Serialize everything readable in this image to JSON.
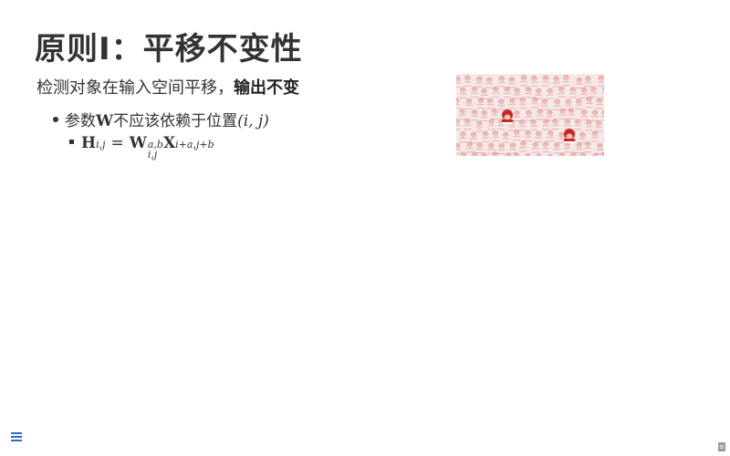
{
  "slide": {
    "title": "原则I：平移不变性",
    "subtitle_plain": "检测对象在输入空间平移，",
    "subtitle_bold": "输出不变",
    "bullet": {
      "text_before": "参数",
      "symbol_W": "W",
      "text_after": "不应该依赖于位置",
      "position": "(i, j)"
    },
    "formula": {
      "H": "H",
      "H_sub": "i,j",
      "equals": "=",
      "W": "W",
      "W_sup": "a,b",
      "W_sub": "i,j",
      "X": "X",
      "X_sub": "i+a,j+b"
    }
  },
  "image": {
    "description_icon": "crowd-image"
  },
  "footer": {
    "menu_icon": "menu-icon",
    "page_icon": "page-icon"
  },
  "colors": {
    "title": "#333333",
    "menu_accent": "#2b6cc4",
    "crowd_red": "#d94b4b",
    "crowd_white": "#f7f1f1"
  }
}
